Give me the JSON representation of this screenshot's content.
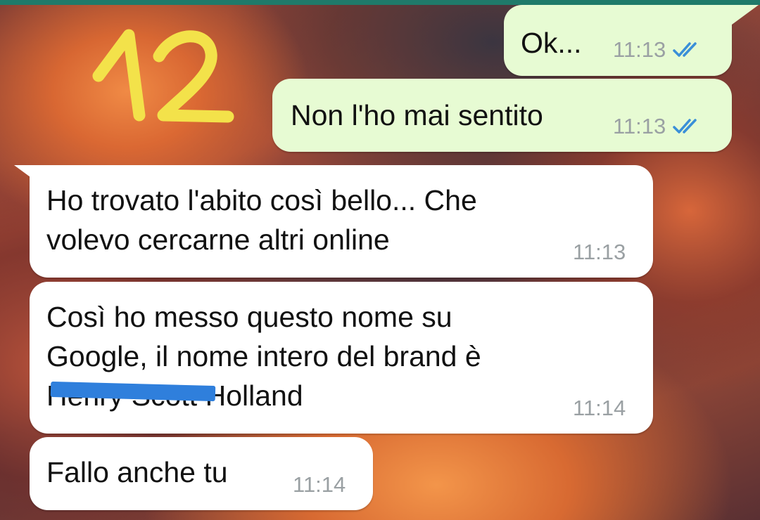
{
  "sticker": {
    "text": "12"
  },
  "messages": [
    {
      "direction": "outgoing",
      "text": "Ok...",
      "time": "11:13",
      "status": "read"
    },
    {
      "direction": "outgoing",
      "text": "Non l'ho mai sentito",
      "time": "11:13",
      "status": "read"
    },
    {
      "direction": "incoming",
      "lines": [
        "Ho trovato l'abito così bello... Che",
        "volevo cercarne altri online"
      ],
      "time": "11:13"
    },
    {
      "direction": "incoming",
      "lines": [
        "Così ho messo questo nome su",
        "Google, il nome intero del brand è",
        "Henry Scott Holland"
      ],
      "time": "11:14"
    },
    {
      "direction": "incoming",
      "text": "Fallo anche tu",
      "time": "11:14"
    }
  ],
  "colors": {
    "outgoing_bubble": "#e7fbd3",
    "incoming_bubble": "#ffffff",
    "read_ticks": "#3a8fd8",
    "sticker": "#f3e24a",
    "redaction": "#2f7fdc",
    "top_bar": "#1f7a6a"
  },
  "icons": {
    "read_receipt": "double-check-icon"
  }
}
